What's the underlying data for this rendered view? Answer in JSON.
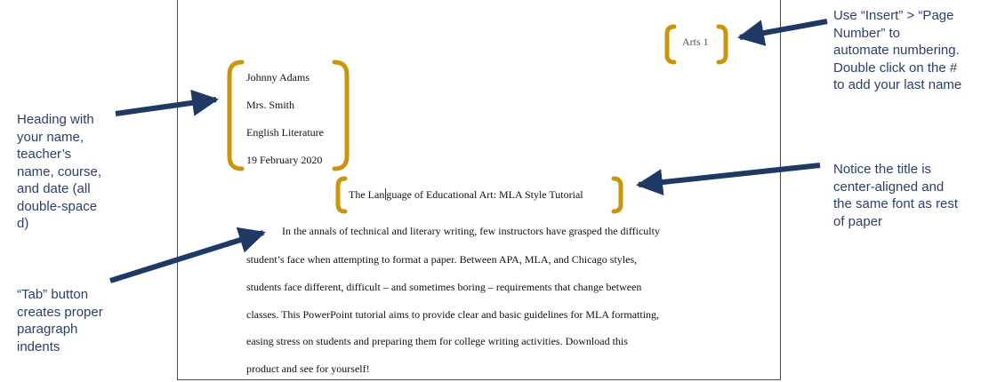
{
  "document": {
    "page_number": "Arts 1",
    "heading": [
      "Johnny Adams",
      "Mrs. Smith",
      "English Literature",
      "19 February 2020"
    ],
    "title_part1": "The Lan",
    "title_part2": "guage of Educational Art: MLA Style Tutorial",
    "paragraph_lines": [
      "In the annals of technical and literary writing, few instructors have grasped the difficulty",
      "student’s face when attempting to format a paper. Between APA, MLA, and Chicago styles,",
      "students face different, difficult – and sometimes boring – requirements that change between",
      "classes. This PowerPoint tutorial aims to provide clear and basic guidelines for MLA formatting,",
      "easing stress on students and preparing them for college writing activities. Download this",
      "product and see for yourself!"
    ]
  },
  "callouts": {
    "page_number_lines": [
      "Use “Insert” > “Page",
      "Number” to",
      "automate numbering.",
      "Double click on the #",
      "to add your last name"
    ],
    "heading_lines": [
      "Heading with",
      "your name,",
      "teacher’s",
      "name, course,",
      "and date (all",
      "double-space",
      "d)"
    ],
    "title_lines": [
      "Notice the title is",
      "center-aligned and",
      "the same font as rest",
      "of paper"
    ],
    "tab_lines": [
      "“Tab” button",
      "creates proper",
      "paragraph",
      "indents"
    ]
  },
  "colors": {
    "bracket": "#c9960b",
    "arrow": "#1f3864",
    "callout_text": "#2b3f6b",
    "page_border": "#3c4a78"
  }
}
